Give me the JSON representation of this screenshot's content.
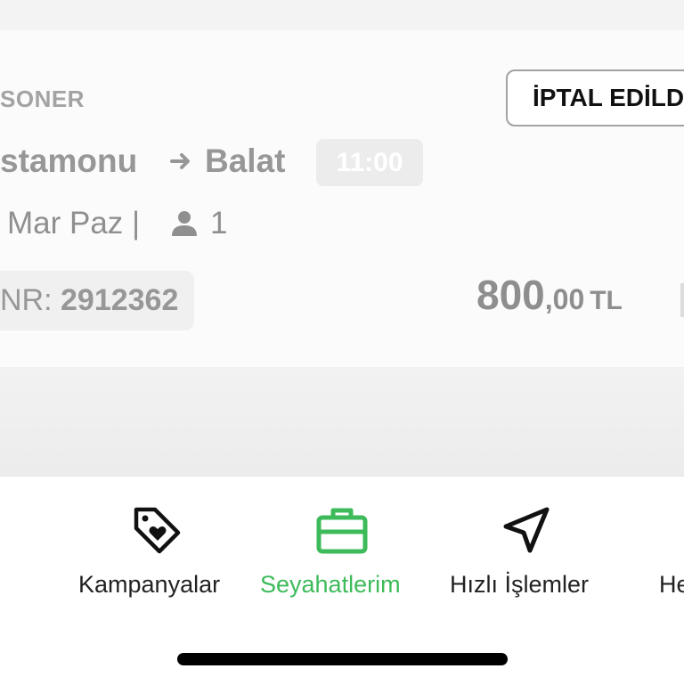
{
  "ticket": {
    "company_logo": "SONER",
    "status": "İPTAL EDİLD",
    "origin": "stamonu",
    "arrow": "→",
    "destination": "Balat",
    "time": "11:00",
    "date": "Mar Paz",
    "separator": "|",
    "passenger_count": "1",
    "pnr_label": "NR:",
    "pnr_value": "2912362",
    "price_int": "800",
    "price_dec": ",00",
    "currency": "TL"
  },
  "tabs": [
    {
      "label": "Kampanyalar",
      "icon": "tag-heart-icon",
      "active": false
    },
    {
      "label": "Seyahatlerim",
      "icon": "briefcase-icon",
      "active": true
    },
    {
      "label": "Hızlı İşlemler",
      "icon": "navigation-arrow-icon",
      "active": false
    },
    {
      "label": "He",
      "icon": "",
      "active": false
    }
  ],
  "colors": {
    "accent_green": "#3dbb5a",
    "muted_text": "#979797",
    "tab_text": "#222222"
  }
}
